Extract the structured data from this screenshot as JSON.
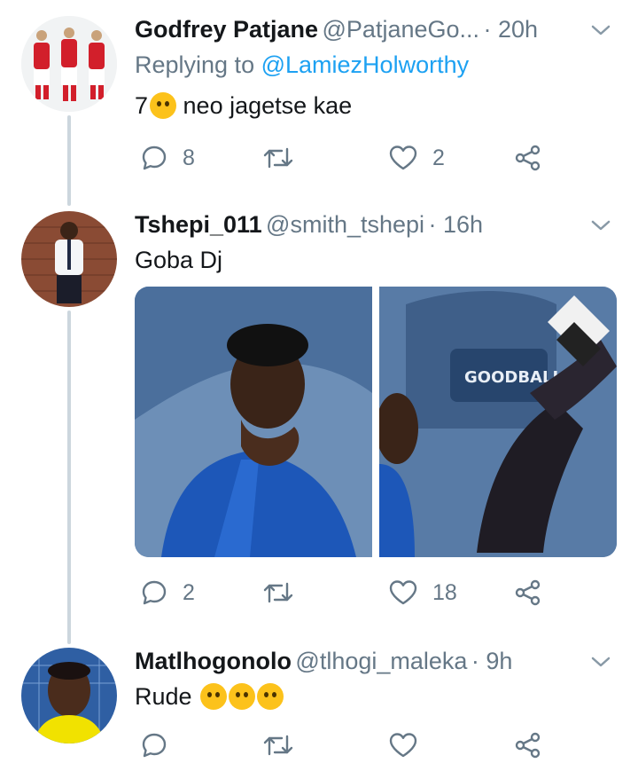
{
  "tweets": [
    {
      "name": "Godfrey Patjane",
      "handle": "@PatjaneGo...",
      "time": "· 20h",
      "replying_prefix": "Replying to",
      "replying_to": "@LamiezHolworthy",
      "text_before_emoji": "7",
      "emoji": "thinking-face-emoji",
      "text_after_emoji": " neo jagetse kae",
      "replies": "8",
      "retweets": "",
      "likes": "2"
    },
    {
      "name": "Tshepi_011",
      "handle": "@smith_tshepi",
      "time": "· 16h",
      "text": "Goba Dj",
      "media_text": "GOODBALL",
      "replies": "2",
      "retweets": "",
      "likes": "18"
    },
    {
      "name": "Matlhogonolo",
      "handle": "@tlhogi_maleka",
      "time": "· 9h",
      "text": "Rude",
      "emojis": [
        "loudly-crying-face-emoji",
        "rolling-on-floor-laughing-emoji",
        "rolling-on-floor-laughing-emoji"
      ],
      "replies": "",
      "retweets": "",
      "likes": ""
    }
  ],
  "colors": {
    "text": "#14171a",
    "secondary": "#657786",
    "link": "#1da1f2",
    "thread_line": "#ccd6dd",
    "emoji": "#fcc21b"
  }
}
